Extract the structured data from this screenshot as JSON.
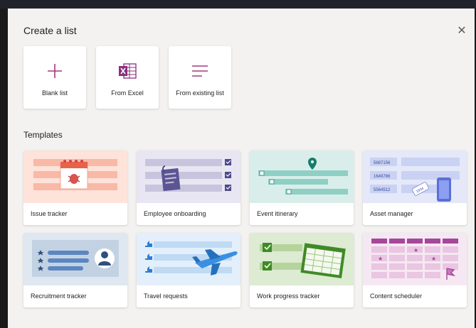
{
  "dialog": {
    "title": "Create a list",
    "close_icon": "close-icon"
  },
  "create_options": [
    {
      "label": "Blank list",
      "icon": "plus-icon"
    },
    {
      "label": "From Excel",
      "icon": "excel-icon"
    },
    {
      "label": "From existing list",
      "icon": "lines-icon"
    }
  ],
  "templates_heading": "Templates",
  "templates": [
    {
      "label": "Issue tracker"
    },
    {
      "label": "Employee onboarding"
    },
    {
      "label": "Event itinerary"
    },
    {
      "label": "Asset manager",
      "asset_numbers": [
        "5687156",
        "1649786",
        "5564512"
      ],
      "tag_number": "1934"
    },
    {
      "label": "Recruitment tracker"
    },
    {
      "label": "Travel requests"
    },
    {
      "label": "Work progress tracker"
    },
    {
      "label": "Content scheduler"
    }
  ],
  "colors": {
    "accent": "#a4387f",
    "excel_purple": "#8a2f7d",
    "issue_bg": "#fde3da",
    "onboarding_bg": "#e8e6f2",
    "itinerary_bg": "#d9eeea",
    "asset_bg": "#e4e8f8",
    "recruit_bg": "#dfe7f0",
    "travel_bg": "#e3effa",
    "progress_bg": "#dcebd2",
    "content_bg": "#f6e8f3"
  }
}
